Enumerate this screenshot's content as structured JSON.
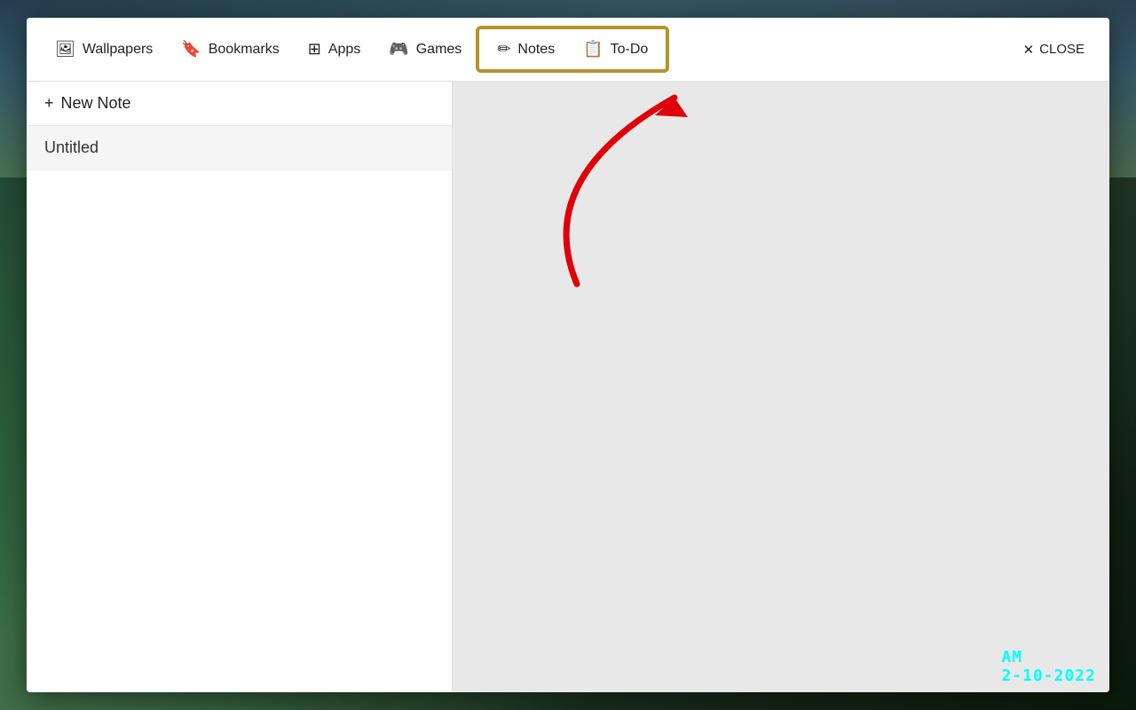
{
  "background": {
    "description": "nature desktop wallpaper with sky and trees"
  },
  "nav": {
    "items": [
      {
        "id": "wallpapers",
        "label": "Wallpapers",
        "icon": "🖼"
      },
      {
        "id": "bookmarks",
        "label": "Bookmarks",
        "icon": "🔖"
      },
      {
        "id": "apps",
        "label": "Apps",
        "icon": "⊞"
      },
      {
        "id": "games",
        "label": "Games",
        "icon": "🎮"
      },
      {
        "id": "notes",
        "label": "Notes",
        "icon": "✏"
      },
      {
        "id": "todo",
        "label": "To-Do",
        "icon": "📋"
      }
    ],
    "close_label": "CLOSE",
    "highlight_color": "#b8922a"
  },
  "sidebar": {
    "new_note_label": "New Note",
    "new_note_prefix": "+ ",
    "notes": [
      {
        "id": "1",
        "title": "Untitled"
      }
    ]
  },
  "clock": {
    "time": "AM",
    "date": "2-10-2022"
  }
}
